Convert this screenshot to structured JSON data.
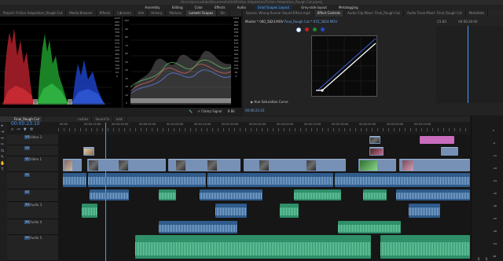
{
  "window": {
    "title": "/Users/prvd.adobe/Documents/Unf/Fiction Adaptation/Fiction Adaptation_Rough Cut.prproj"
  },
  "workspaces": [
    "Assembly",
    "Editing",
    "Color",
    "Effects",
    "Audio",
    "Grad Scopes Layout",
    "Grey-side layout",
    "Metalogging"
  ],
  "active_workspace": "Grad Scopes Layout",
  "left_tabs": [
    "Project: Fiction Adaptation_Rough Cut",
    "Media Browser",
    "Effects",
    "Libraries",
    "Info",
    "History",
    "Markers",
    "Lumetri Scopes",
    "Bin"
  ],
  "left_active_tab": "Lumetri Scopes",
  "right_tabs": [
    "Source: Wrong Runner Sound Effect.mp4",
    "Effect Controls",
    "Audio Clip Mixer: Final_Rough Cut",
    "Audio Track Mixer: Final_Rough Cut",
    "Metadata"
  ],
  "right_active_tab": "Effect Controls",
  "scopes": {
    "parade_scale": [
      "1023",
      "960",
      "896",
      "832",
      "768",
      "704",
      "640",
      "576",
      "512",
      "448",
      "384",
      "320",
      "256",
      "192",
      "128",
      "64",
      "0"
    ],
    "percent_scale": [
      "100",
      "90",
      "80",
      "70",
      "60",
      "50",
      "40",
      "30",
      "20",
      "10",
      "0"
    ],
    "clamp_label": "Clamp Signal",
    "bit_label": "8 Bit",
    "wrench_icon": "wrench-icon"
  },
  "effect_controls": {
    "master_label": "Master * 000_5824.MOV",
    "clip_label": "Final_Rough Cut * XYZ_5824.MOV",
    "timecode_start": ":15:00",
    "timecode_end": "00:00:30:00",
    "curve_label": "Hue Saturation Curve",
    "current_time": "00:00:23:10",
    "channels": [
      {
        "name": "white",
        "color": "#ffffff"
      },
      {
        "name": "red",
        "color": "#c52020"
      },
      {
        "name": "green",
        "color": "#1e8a2a"
      },
      {
        "name": "blue",
        "color": "#1f4ad0"
      }
    ]
  },
  "sequence": {
    "tabs": [
      "Final_Rough Cut",
      "rushes",
      "Sound fx",
      "end"
    ],
    "timecode": "00:00:23:10",
    "ruler": [
      "00:00",
      "00:00:15:00",
      "00:00:30:00",
      "00:00:45:00",
      "00:01:00:00",
      "00:01:15:00",
      "00:01:30:00",
      "00:01:45:00",
      "00:02:00:00",
      "00:02:15:00",
      "00:02:30:00",
      "00:02:45:00",
      "00:03:00:00",
      "00:03:15:00"
    ],
    "tracks": [
      {
        "id": "V3",
        "name": "Video 3"
      },
      {
        "id": "V2",
        "name": ""
      },
      {
        "id": "V1",
        "name": "Video 1"
      },
      {
        "id": "A1",
        "name": "A1"
      },
      {
        "id": "A2",
        "name": ""
      },
      {
        "id": "A3",
        "name": "Audio 3"
      },
      {
        "id": "A4",
        "name": "Audio 4"
      },
      {
        "id": "A5",
        "name": "Audio 5"
      }
    ],
    "clip_name": "fx"
  },
  "meter": {
    "scale": [
      "0",
      "-6",
      "-12",
      "-18",
      "-24",
      "-30",
      "-36",
      "-42",
      "-48",
      "-54",
      "dB"
    ],
    "footer": [
      "S",
      "S"
    ]
  },
  "colors": {
    "accent": "#6ea6e8",
    "playhead": "#4a9eff",
    "video_clip": "#7790b5",
    "audio_clip": "#2f8f68"
  }
}
